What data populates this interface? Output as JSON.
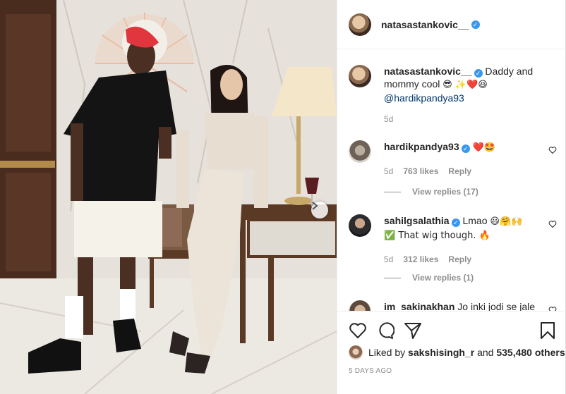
{
  "post": {
    "author": "natasastankovic__",
    "caption": {
      "username": "natasastankovic__",
      "text": "Daddy and mommy cool",
      "emojis": "😎 ✨❤️😆",
      "mention": "@hardikpandya93",
      "time": "5d"
    },
    "comments": [
      {
        "username": "hardikpandya93",
        "text": "",
        "emojis": "❤️🤩",
        "time": "5d",
        "likes": "763 likes",
        "reply_label": "Reply",
        "view_replies": "View replies (17)"
      },
      {
        "username": "sahilgsalathia",
        "text": "Lmao",
        "emojis": "😃🤗🙌",
        "text2": "✅ That wig though. 🔥",
        "time": "5d",
        "likes": "312 likes",
        "reply_label": "Reply",
        "view_replies": "View replies (1)"
      },
      {
        "username": "im_sakinakhan",
        "text": "Jo inki jodi se jale"
      }
    ],
    "liked_by": {
      "prefix": "Liked by",
      "user": "sakshisingh_r",
      "middle": "and",
      "others": "535,480 others"
    },
    "timestamp": "5 DAYS AGO",
    "icons": [
      "heart-icon",
      "comment-icon",
      "share-icon",
      "bookmark-icon"
    ],
    "colors": {
      "verified": "#3897f0",
      "link": "#00376b",
      "muted": "#8e8e8e"
    }
  }
}
